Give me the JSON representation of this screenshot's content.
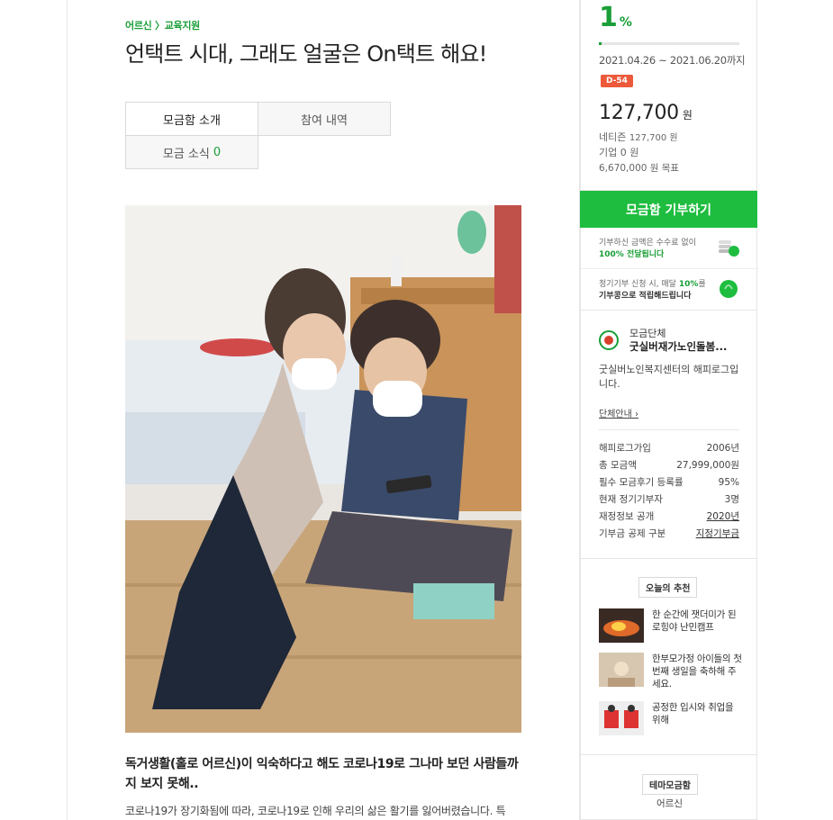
{
  "breadcrumb": "어르신 〉교육지원",
  "title": "언택트 시대, 그래도 얼굴은 On택트 해요!",
  "tabs": {
    "intro": "모금함 소개",
    "history": "참여 내역",
    "news": "모금 소식",
    "news_count": "0"
  },
  "photo": {
    "icon": "photo-elderly-women-smartphone"
  },
  "content": {
    "lead": "독거생활(홀로 어르신)이 익숙하다고 해도 코로나19로 그나마 보던 사람들까지 보지 못해..",
    "body": "코로나19가 장기화됨에 따라, 코로나19로 인해 우리의 삶은 활기를 잃어버렸습니다. 특"
  },
  "sidebar": {
    "progress_value": "1",
    "progress_unit": "%",
    "progress_fraction": 0.019,
    "period": "2021.04.26 ~ 2021.06.20까지",
    "dday": "D-54",
    "amount": "127,700",
    "amount_unit": "원",
    "netizen_label": "네티즌",
    "netizen_amount": "127,700 원",
    "company": "기업 0 원",
    "goal": "6,670,000 원 목표",
    "donate_button": "모금함 기부하기",
    "info1_pre": "기부하신 금액은 수수료 없이",
    "info1_hl": "100% 전달됩니다",
    "info2_pre": "정기기부 신청 시, 매달",
    "info2_hl": "10%",
    "info2_post": "를",
    "info2_b": "기부콩으로 적립해드립니다",
    "colors": {
      "accent": "#1a9e37",
      "button": "#1ebd3f",
      "dday": "#ec5a3a"
    }
  },
  "org": {
    "label": "모금단체",
    "name": "굿실버재가노인돌봄...",
    "desc": "굿실버노인복지센터의 해피로그입니다.",
    "link": "단체안내 ›",
    "stats": [
      {
        "label": "해피로그가입",
        "value": "2006년"
      },
      {
        "label": "총 모금액",
        "value": "27,999,000원"
      },
      {
        "label": "필수 모금후기 등록률",
        "value": "95%"
      },
      {
        "label": "현재 정기기부자",
        "value": "3명"
      },
      {
        "label": "재정정보 공개",
        "value": "2020년"
      },
      {
        "label": "기부금 공제 구분",
        "value": "지정기부금"
      }
    ]
  },
  "recommend": {
    "title": "오늘의 추천",
    "items": [
      {
        "text": "한 순간에 잿더미가 된 로힝야 난민캠프"
      },
      {
        "text": "한부모가정 아이들의 첫 번째 생일을 축하해 주세요."
      },
      {
        "text": "공정한 입시와 취업을 위해"
      }
    ]
  },
  "theme": {
    "title": "테마모금함",
    "value": "어르신"
  }
}
